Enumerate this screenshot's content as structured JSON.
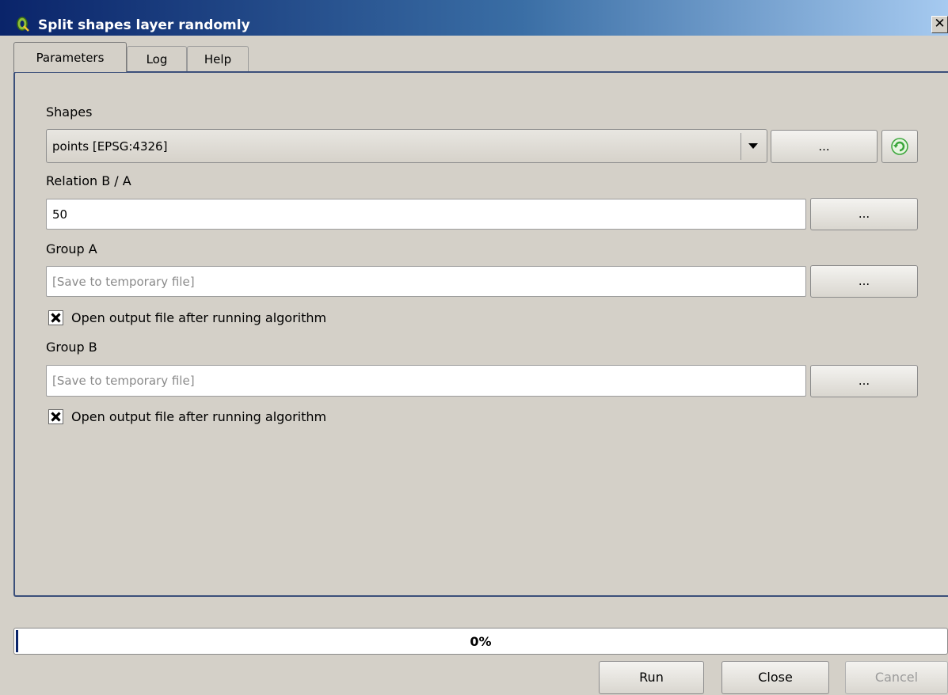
{
  "window": {
    "title": "Split shapes layer randomly",
    "close_glyph": "✕",
    "icon": "qgis-logo-icon"
  },
  "tabs": [
    {
      "label": "Parameters",
      "active": true
    },
    {
      "label": "Log",
      "active": false
    },
    {
      "label": "Help",
      "active": false
    }
  ],
  "params": {
    "shapes": {
      "label": "Shapes",
      "selected": "points [EPSG:4326]",
      "browse_label": "...",
      "refresh_icon": "refresh-icon"
    },
    "relation": {
      "label": "Relation B / A",
      "value": "50",
      "browse_label": "..."
    },
    "group_a": {
      "label": "Group A",
      "placeholder": "[Save to temporary file]",
      "browse_label": "...",
      "open_output_label": "Open output file after running algorithm",
      "open_output_checked": true
    },
    "group_b": {
      "label": "Group B",
      "placeholder": "[Save to temporary file]",
      "browse_label": "...",
      "open_output_label": "Open output file after running algorithm",
      "open_output_checked": true
    }
  },
  "progress": {
    "value": 0,
    "label": "0%"
  },
  "buttons": {
    "run": "Run",
    "close": "Close",
    "cancel": "Cancel"
  },
  "colors": {
    "title_gradient_start": "#0a246a",
    "title_gradient_end": "#a6caf0",
    "panel_border": "#3b4f7a",
    "refresh_icon": "#3aa63a"
  }
}
